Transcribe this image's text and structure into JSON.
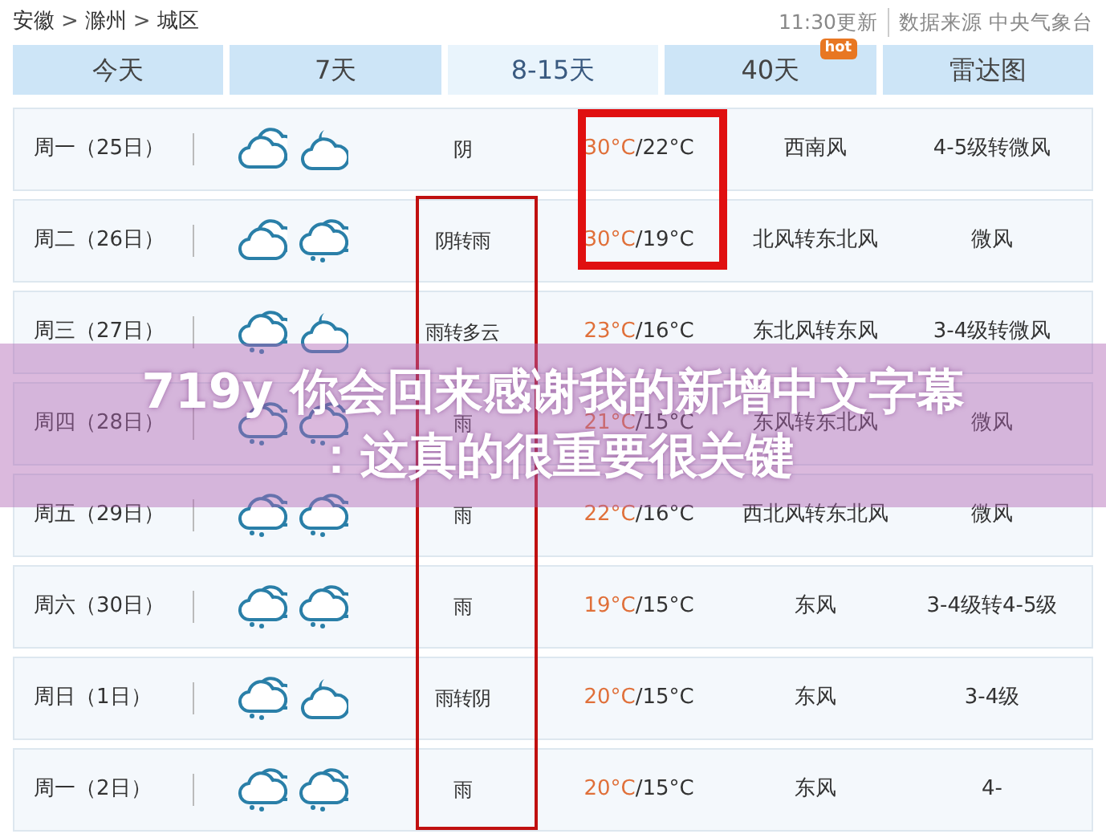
{
  "breadcrumb": [
    {
      "label": "安徽"
    },
    {
      "label": "滁州"
    },
    {
      "label": "城区"
    }
  ],
  "breadcrumb_separator": ">",
  "updated": "11:30更新",
  "source": "数据来源 中央气象台",
  "tabs": [
    {
      "label": "今天",
      "selected": false
    },
    {
      "label": "7天",
      "selected": false
    },
    {
      "label": "8-15天",
      "selected": true
    },
    {
      "label": "40天",
      "selected": false,
      "badge": "hot"
    },
    {
      "label": "雷达图",
      "selected": false
    }
  ],
  "rows": [
    {
      "day": "周一（25日）",
      "icons": [
        {
          "kind": "cloudy"
        },
        {
          "kind": "night-cloudy"
        }
      ],
      "condition": "阴",
      "high": "30°C",
      "low": "/22°C",
      "wind": "西南风",
      "level": "4-5级转微风"
    },
    {
      "day": "周二（26日）",
      "icons": [
        {
          "kind": "cloudy"
        },
        {
          "kind": "rain"
        }
      ],
      "condition": "阴转雨",
      "high": "30°C",
      "low": "/19°C",
      "wind": "北风转东北风",
      "level": "微风"
    },
    {
      "day": "周三（27日）",
      "icons": [
        {
          "kind": "rain"
        },
        {
          "kind": "night-cloudy"
        }
      ],
      "condition": "雨转多云",
      "high": "23°C",
      "low": "/16°C",
      "wind": "东北风转东风",
      "level": "3-4级转微风"
    },
    {
      "day": "周四（28日）",
      "icons": [
        {
          "kind": "rain"
        },
        {
          "kind": "rain"
        }
      ],
      "condition": "雨",
      "high": "21°C",
      "low": "/15°C",
      "wind": "东风转东北风",
      "level": "微风"
    },
    {
      "day": "周五（29日）",
      "icons": [
        {
          "kind": "rain"
        },
        {
          "kind": "rain"
        }
      ],
      "condition": "雨",
      "high": "22°C",
      "low": "/16°C",
      "wind": "西北风转东北风",
      "level": "微风"
    },
    {
      "day": "周六（30日）",
      "icons": [
        {
          "kind": "rain"
        },
        {
          "kind": "rain"
        }
      ],
      "condition": "雨",
      "high": "19°C",
      "low": "/15°C",
      "wind": "东风",
      "level": "3-4级转4-5级"
    },
    {
      "day": "周日（1日）",
      "icons": [
        {
          "kind": "rain"
        },
        {
          "kind": "night-cloudy"
        }
      ],
      "condition": "雨转阴",
      "high": "20°C",
      "low": "/15°C",
      "wind": "东风",
      "level": "3-4级"
    },
    {
      "day": "周一（2日）",
      "icons": [
        {
          "kind": "rain"
        },
        {
          "kind": "rain"
        }
      ],
      "condition": "雨",
      "high": "20°C",
      "low": "/15°C",
      "wind": "东风",
      "level": "4-"
    }
  ],
  "banner": {
    "lines": [
      "719y 你会回来感谢我的新增中文字幕",
      "：这真的很重要很关键"
    ]
  }
}
